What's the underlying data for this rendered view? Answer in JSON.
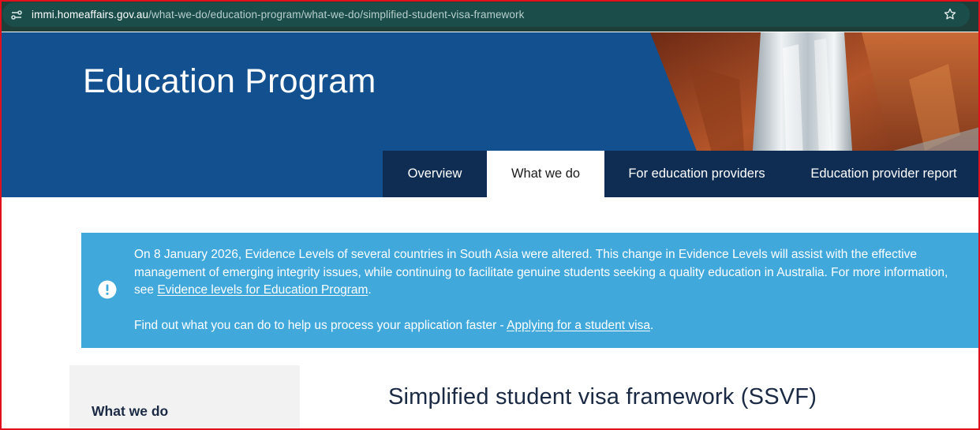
{
  "browser": {
    "url_domain": "immi.homeaffairs.gov.au",
    "url_path": "/what-we-do/education-program/what-we-do/simplified-student-visa-framework",
    "icons": [
      "site-info-icon",
      "bookmark-star-icon"
    ]
  },
  "hero": {
    "title": "Education Program"
  },
  "tabs": [
    {
      "label": "Overview",
      "active": false
    },
    {
      "label": "What we do",
      "active": true
    },
    {
      "label": "For education providers",
      "active": false
    },
    {
      "label": "Education provider report",
      "active": false
    }
  ],
  "alert": {
    "icon": "exclamation-circle-icon",
    "paragraph1_text": "On 8 January 2026, Evidence Levels of several countries in South Asia were altered. This change in Evidence Levels will assist with the effective management of emerging integrity issues, while continuing to facilitate genuine students seeking a quality education in Australia. For more information, see ",
    "paragraph1_link": "Evidence levels for Education Program",
    "paragraph1_end": ".",
    "paragraph2_text": "Find out what you can do to help us process your application faster - ",
    "paragraph2_link": "Applying for a student visa",
    "paragraph2_end": "."
  },
  "sidebar": {
    "title": "What we do"
  },
  "main": {
    "title": "Simplified student visa framework (SSVF)"
  },
  "colors": {
    "hero_blue": "#12508f",
    "tab_bar_navy": "#0f2d52",
    "alert_blue": "#41a8dc",
    "heading_navy": "#1b2a44",
    "address_bar": "#1b4d4a"
  }
}
